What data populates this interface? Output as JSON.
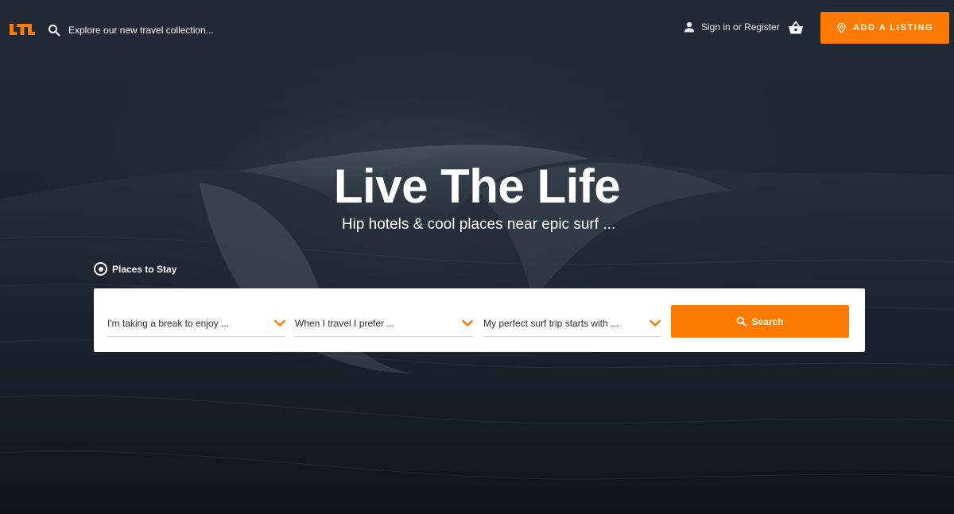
{
  "header": {
    "logo_text": "LTL",
    "search_placeholder": "Explore our new travel collection...",
    "signin_label": "Sign in or Register",
    "add_listing_label": "ADD A LISTING"
  },
  "hero": {
    "title": "Live The Life",
    "subtitle": "Hip hotels & cool places near epic surf ..."
  },
  "search_form": {
    "mode_label": "Places to Stay",
    "dropdowns": [
      {
        "value": "I'm taking a break to enjoy ..."
      },
      {
        "value": "When I travel I prefer ..."
      },
      {
        "value": "My perfect surf trip starts with ..."
      }
    ],
    "search_button_label": "Search"
  },
  "colors": {
    "accent": "#ff7a00",
    "panel": "#ffffff",
    "hero_bg": "#1b242e"
  },
  "icons": [
    "logo-icon",
    "search-icon",
    "user-icon",
    "basket-icon",
    "location-pin-icon",
    "radio-icon",
    "chevron-down-icon"
  ]
}
